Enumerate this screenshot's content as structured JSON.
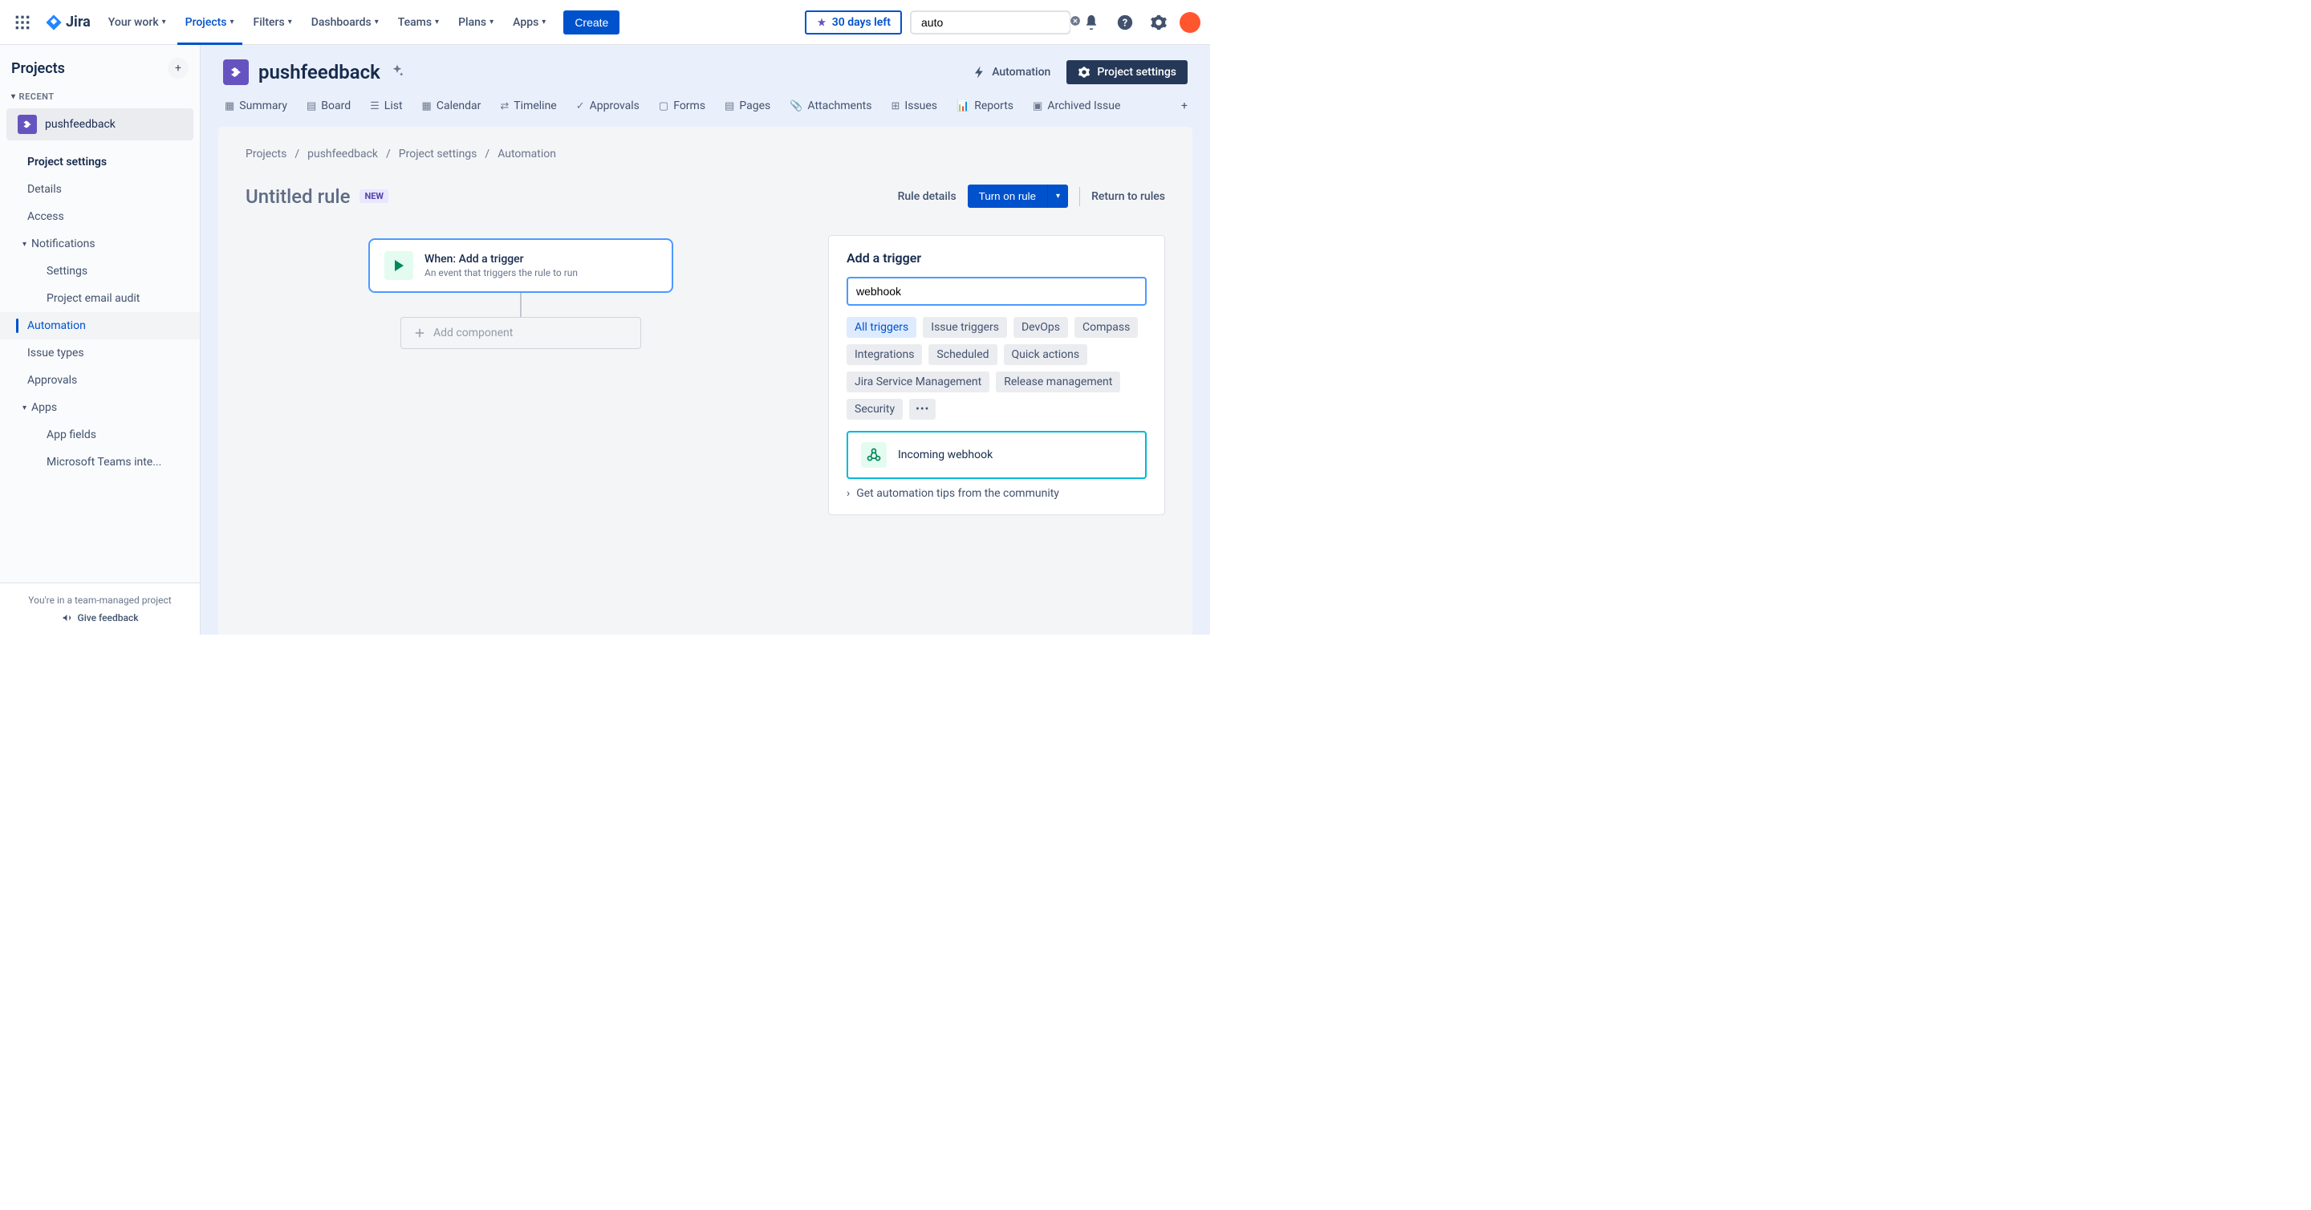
{
  "topnav": {
    "logo": "Jira",
    "items": [
      "Your work",
      "Projects",
      "Filters",
      "Dashboards",
      "Teams",
      "Plans",
      "Apps"
    ],
    "active_index": 1,
    "create": "Create",
    "trial": "30 days left",
    "search_value": "auto"
  },
  "sidebar": {
    "title": "Projects",
    "recent_label": "RECENT",
    "project_name": "pushfeedback",
    "items": [
      {
        "label": "Project settings",
        "type": "heading"
      },
      {
        "label": "Details",
        "type": "item"
      },
      {
        "label": "Access",
        "type": "item"
      },
      {
        "label": "Notifications",
        "type": "expandable"
      },
      {
        "label": "Settings",
        "type": "sub"
      },
      {
        "label": "Project email audit",
        "type": "sub"
      },
      {
        "label": "Automation",
        "type": "item",
        "active": true
      },
      {
        "label": "Issue types",
        "type": "item"
      },
      {
        "label": "Approvals",
        "type": "item"
      },
      {
        "label": "Apps",
        "type": "expandable"
      },
      {
        "label": "App fields",
        "type": "sub"
      },
      {
        "label": "Microsoft Teams inte...",
        "type": "sub"
      }
    ],
    "footer_note": "You're in a team-managed project",
    "feedback": "Give feedback"
  },
  "project": {
    "name": "pushfeedback",
    "automation_label": "Automation",
    "settings_label": "Project settings",
    "tabs": [
      "Summary",
      "Board",
      "List",
      "Calendar",
      "Timeline",
      "Approvals",
      "Forms",
      "Pages",
      "Attachments",
      "Issues",
      "Reports",
      "Archived Issue"
    ]
  },
  "breadcrumb": [
    "Projects",
    "pushfeedback",
    "Project settings",
    "Automation"
  ],
  "rule": {
    "title": "Untitled rule",
    "badge": "NEW",
    "details": "Rule details",
    "turn_on": "Turn on rule",
    "return": "Return to rules",
    "trigger_title": "When: Add a trigger",
    "trigger_sub": "An event that triggers the rule to run",
    "add_component": "Add component"
  },
  "panel": {
    "title": "Add a trigger",
    "input_value": "webhook",
    "chips": [
      "All triggers",
      "Issue triggers",
      "DevOps",
      "Compass",
      "Integrations",
      "Scheduled",
      "Quick actions",
      "Jira Service Management",
      "Release management",
      "Security"
    ],
    "active_chip": 0,
    "result": "Incoming webhook",
    "tips": "Get automation tips from the community"
  }
}
